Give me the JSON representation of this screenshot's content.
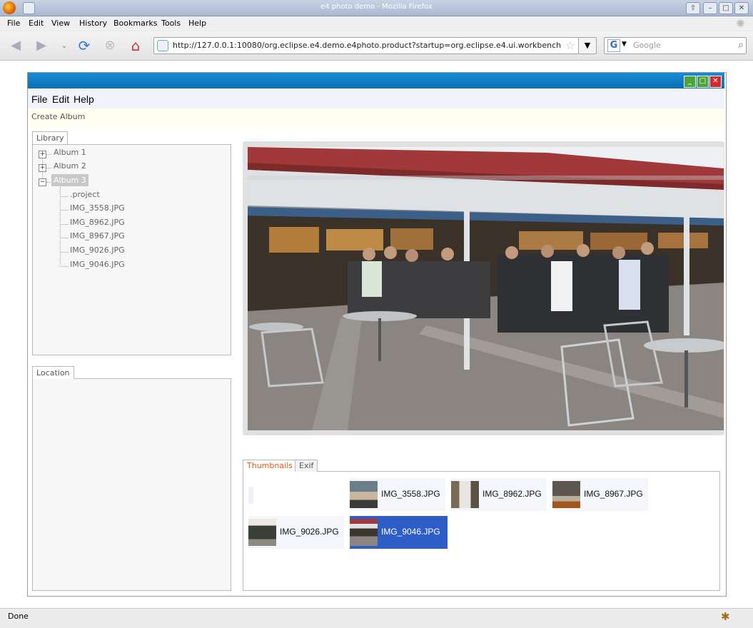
{
  "browser": {
    "title": "e4 photo demo - Mozilla Firefox",
    "menu": [
      "File",
      "Edit",
      "View",
      "History",
      "Bookmarks",
      "Tools",
      "Help"
    ],
    "url": "http://127.0.0.1:10080/org.eclipse.e4.demo.e4photo.product?startup=org.eclipse.e4.ui.workbench.swt.applicatio",
    "search_placeholder": "Google",
    "status": "Done"
  },
  "app": {
    "menu": [
      "File",
      "Edit",
      "Help"
    ],
    "toolbar": {
      "create_album": "Create Album"
    },
    "library": {
      "tab": "Library",
      "albums": [
        "Album 1",
        "Album 2",
        "Album 3"
      ],
      "selected_album": "Album 3",
      "files": [
        ".project",
        "IMG_3558.JPG",
        "IMG_8962.JPG",
        "IMG_8967.JPG",
        "IMG_9026.JPG",
        "IMG_9046.JPG"
      ]
    },
    "location": {
      "tab": "Location"
    },
    "bottom_tabs": {
      "active": "Thumbnails",
      "other": "Exif"
    },
    "thumbnails": [
      "IMG_3558.JPG",
      "IMG_8962.JPG",
      "IMG_8967.JPG",
      "IMG_9026.JPG",
      "IMG_9046.JPG"
    ],
    "selected_thumbnail": "IMG_9046.JPG"
  },
  "colors": {
    "titlebar": "#0a6fb2",
    "selection": "#2d5ec7",
    "active_tab": "#e05a10"
  }
}
